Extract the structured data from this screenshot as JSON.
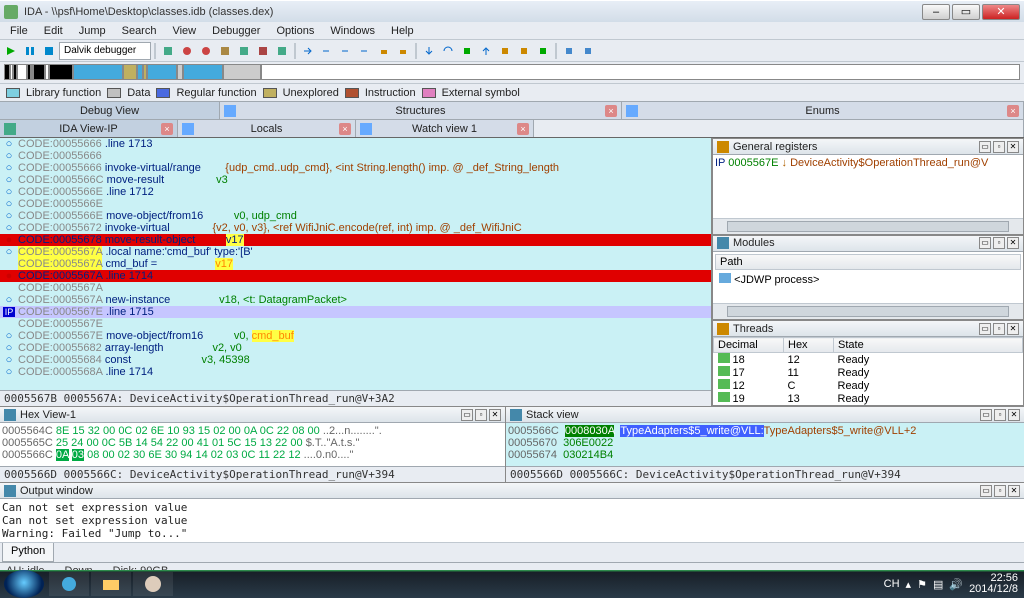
{
  "window": {
    "title": "IDA - \\\\psf\\Home\\Desktop\\classes.idb  (classes.dex)"
  },
  "menu": [
    "File",
    "Edit",
    "Jump",
    "Search",
    "View",
    "Debugger",
    "Options",
    "Windows",
    "Help"
  ],
  "toolbar": {
    "debugger_combo": "Dalvik debugger"
  },
  "legend": [
    {
      "color": "#7ecfe0",
      "label": "Library function"
    },
    {
      "color": "#c0c0c0",
      "label": "Data"
    },
    {
      "color": "#4a6ae0",
      "label": "Regular function"
    },
    {
      "color": "#c0b060",
      "label": "Unexplored"
    },
    {
      "color": "#b05030",
      "label": "Instruction"
    },
    {
      "color": "#e080c0",
      "label": "External symbol"
    }
  ],
  "top_tabs": [
    "Debug View",
    "Structures",
    "Enums"
  ],
  "sub_tabs": [
    "IDA View-IP",
    "Locals",
    "Watch view 1"
  ],
  "disasm": {
    "rows": [
      {
        "g": "o",
        "addr": "CODE:00055666",
        "mn": ".line 1713"
      },
      {
        "g": "o",
        "addr": "CODE:00055666"
      },
      {
        "g": "o",
        "addr": "CODE:00055666",
        "mn": "invoke-virtual/range",
        "arg": "{udp_cmd..udp_cmd}, <int String.length() imp. @ _def_String_length",
        "argcls": "argref"
      },
      {
        "g": "o",
        "addr": "CODE:0005566C",
        "mn": "move-result",
        "arg": "v3"
      },
      {
        "g": "o",
        "addr": "CODE:0005566E",
        "mn": ".line 1712"
      },
      {
        "g": "o",
        "addr": "CODE:0005566E"
      },
      {
        "g": "o",
        "addr": "CODE:0005566E",
        "mn": "move-object/from16",
        "arg": "v0, udp_cmd"
      },
      {
        "g": "o",
        "addr": "CODE:00055672",
        "mn": "invoke-virtual",
        "arg": "{v2, v0, v3}, <ref WifiJniC.encode(ref, int) imp. @ _def_WifiJniC",
        "argcls": "argref"
      },
      {
        "g": "●",
        "addr": "CODE:00055678",
        "mn": "move-result-object",
        "arg": "v17",
        "cls": "red",
        "arghl": true
      },
      {
        "g": "o",
        "addr": "CODE:0005567A",
        "mn": ".local name:'cmd_buf' type:'[B'",
        "yellowaddr": true
      },
      {
        "g": " ",
        "addr": "CODE:0005567A",
        "mn": "cmd_buf = ",
        "arg": "v17",
        "yellowaddr": true,
        "arghl": true,
        "argor": true
      },
      {
        "g": "●",
        "addr": "CODE:0005567A",
        "mn": ".line 1714",
        "cls": "red"
      },
      {
        "g": " ",
        "addr": "CODE:0005567A"
      },
      {
        "g": "o",
        "addr": "CODE:0005567A",
        "mn": "new-instance",
        "arg": "v18, <t: DatagramPacket>"
      },
      {
        "g": "IP",
        "addr": "CODE:0005567E",
        "mn": ".line 1715",
        "cls": "purple"
      },
      {
        "g": " ",
        "addr": "CODE:0005567E"
      },
      {
        "g": "o",
        "addr": "CODE:0005567E",
        "mn": "move-object/from16",
        "arg": "v0, cmd_buf",
        "arghl": true,
        "argor": true,
        "splitarg": "v0, "
      },
      {
        "g": "o",
        "addr": "CODE:00055682",
        "mn": "array-length",
        "arg": "v2, v0"
      },
      {
        "g": "o",
        "addr": "CODE:00055684",
        "mn": "const",
        "arg": "v3, 45398"
      },
      {
        "g": "o",
        "addr": "CODE:0005568A",
        "mn": ".line 1714"
      }
    ],
    "status": "0005567B 0005567A: DeviceActivity$OperationThread_run@V+3A2"
  },
  "registers": {
    "title": "General registers",
    "line": "IP 0005567E  ↓ DeviceActivity$OperationThread_run@V"
  },
  "modules": {
    "title": "Modules",
    "col": "Path",
    "rows": [
      "<JDWP process>"
    ]
  },
  "threads": {
    "title": "Threads",
    "cols": [
      "Decimal",
      "Hex",
      "State"
    ],
    "rows": [
      {
        "dec": "18",
        "hex": "12",
        "state": "Ready"
      },
      {
        "dec": "17",
        "hex": "11",
        "state": "Ready"
      },
      {
        "dec": "12",
        "hex": "C",
        "state": "Ready"
      },
      {
        "dec": "19",
        "hex": "13",
        "state": "Ready"
      }
    ]
  },
  "hex": {
    "title": "Hex View-1",
    "rows": [
      {
        "addr": "0005564C",
        "bytes": "8E 15 32 00 0C 02 6E 10  93 15 02 00 0A 0C 22 08 00",
        "ascii": "..2...n........\"."
      },
      {
        "addr": "0005565C",
        "bytes": "25 24 00 0C 5B 14 54 22  00 41 01 5C 15 13 22 00",
        "ascii": "$.T..\"A.t.s.\""
      },
      {
        "addr": "0005566C",
        "bytes": "0A 03 08 00 02 30 6E 30  94 14 02 03 0C 11 22 12",
        "ascii": "....0.n0....\"",
        "hl": [
          0,
          1
        ]
      }
    ],
    "status": "0005566D 0005566C: DeviceActivity$OperationThread_run@V+394"
  },
  "stack": {
    "title": "Stack view",
    "rows": [
      {
        "addr": "0005566C",
        "val": "0008030A",
        "type": "TypeAdapters$5_write@VLL:",
        "txt": "TypeAdapters$5_write@VLL+2",
        "hl": true
      },
      {
        "addr": "00055670",
        "val": "306E0022"
      },
      {
        "addr": "00055674",
        "val": "030214B4"
      }
    ],
    "status": "0005566D 0005566C: DeviceActivity$OperationThread_run@V+394"
  },
  "output": {
    "title": "Output window",
    "lines": [
      "Can not set expression value",
      "Can not set expression value",
      "Warning: Failed \"Jump to...\""
    ],
    "tab": "Python"
  },
  "status": {
    "au": "AU:  idle",
    "down": "Down",
    "disk": "Disk: 90GB"
  },
  "clock": {
    "time": "22:56",
    "date": "2014/12/8",
    "lang": "CH"
  }
}
